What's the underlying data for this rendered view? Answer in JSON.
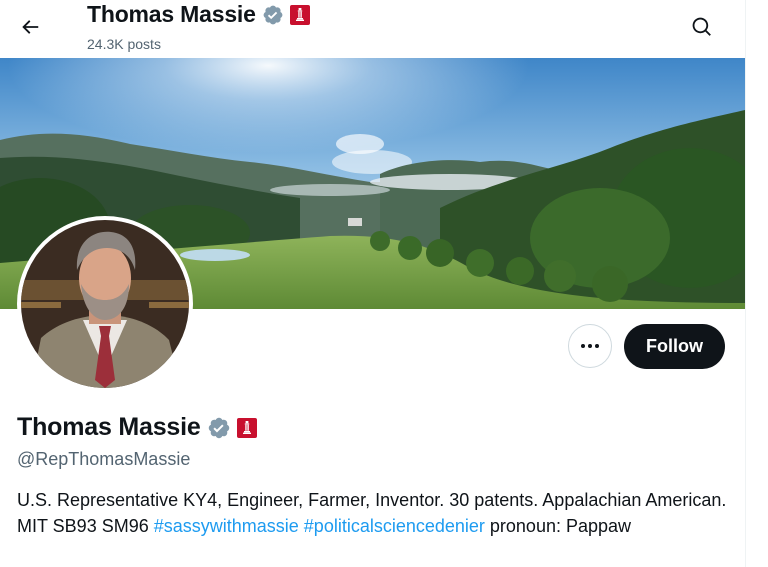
{
  "header": {
    "name": "Thomas Massie",
    "posts": "24.3K posts",
    "back_icon": "arrow-left-icon",
    "search_icon": "search-icon"
  },
  "profile": {
    "name": "Thomas Massie",
    "handle": "@RepThomasMassie",
    "verified_badge": "verified-badge-icon",
    "affiliation_badge": "us-house-badge-icon",
    "bio": {
      "text_before": "U.S. Representative KY4, Engineer, Farmer, Inventor. 30 patents. Appalachian American. MIT SB93 SM96 ",
      "hashtag1": "#sassywithmassie",
      "space": " ",
      "hashtag2": "#politicalsciencedenier",
      "text_after": " pronoun: Pappaw"
    }
  },
  "actions": {
    "more_label": "•••",
    "follow_label": "Follow"
  },
  "colors": {
    "verified": "#829aab",
    "house_badge": "#c8102e",
    "link": "#1d9bf0",
    "follow_bg": "#0f1419",
    "secondary_text": "#536471"
  }
}
